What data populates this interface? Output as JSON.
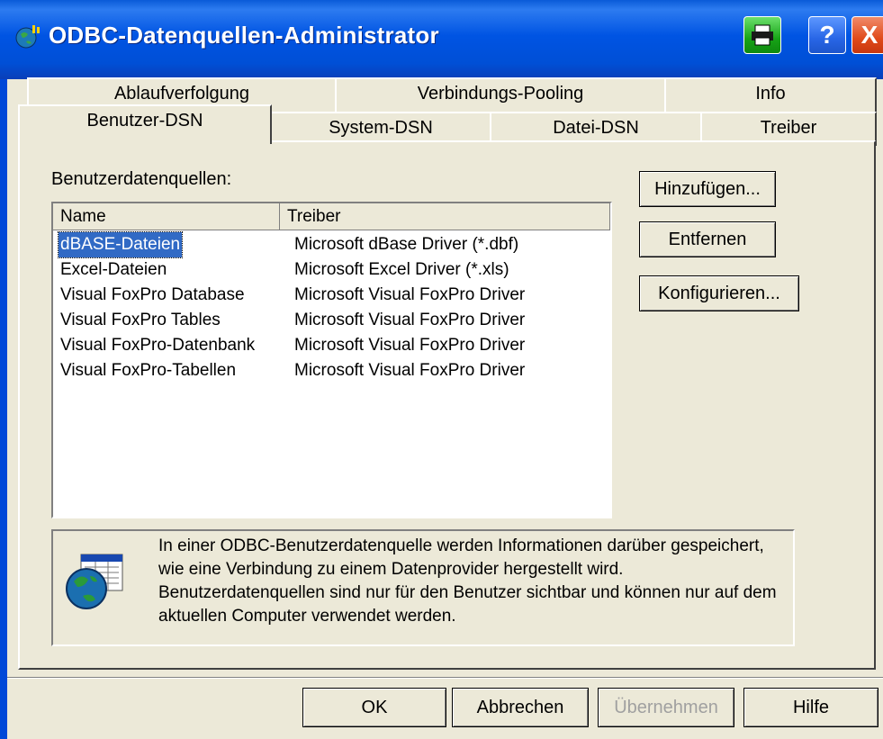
{
  "window": {
    "title": "ODBC-Datenquellen-Administrator"
  },
  "title_buttons": {
    "help": "?",
    "close": "X"
  },
  "tabs_back": [
    {
      "label": "Ablaufverfolgung"
    },
    {
      "label": "Verbindungs-Pooling"
    },
    {
      "label": "Info"
    }
  ],
  "tabs_front": [
    {
      "label": "Benutzer-DSN",
      "active": true
    },
    {
      "label": "System-DSN"
    },
    {
      "label": "Datei-DSN"
    },
    {
      "label": "Treiber"
    }
  ],
  "main": {
    "list_label": "Benutzerdatenquellen:",
    "columns": [
      "Name",
      "Treiber"
    ],
    "rows": [
      {
        "name": "dBASE-Dateien",
        "driver": "Microsoft dBase Driver (*.dbf)",
        "selected": true
      },
      {
        "name": "Excel-Dateien",
        "driver": "Microsoft Excel Driver (*.xls)"
      },
      {
        "name": "Visual FoxPro Database",
        "driver": "Microsoft Visual FoxPro Driver"
      },
      {
        "name": "Visual FoxPro Tables",
        "driver": "Microsoft Visual FoxPro Driver"
      },
      {
        "name": "Visual FoxPro-Datenbank",
        "driver": "Microsoft Visual FoxPro Driver"
      },
      {
        "name": "Visual FoxPro-Tabellen",
        "driver": "Microsoft Visual FoxPro Driver"
      }
    ],
    "buttons": {
      "add": "Hinzufügen...",
      "remove": "Entfernen",
      "configure": "Konfigurieren..."
    },
    "info_text": "In einer ODBC-Benutzerdatenquelle werden Informationen darüber gespeichert, wie eine Verbindung zu einem Datenprovider hergestellt wird. Benutzerdatenquellen sind nur für den Benutzer sichtbar und können nur auf dem aktuellen Computer verwendet werden."
  },
  "footer": {
    "ok": "OK",
    "cancel": "Abbrechen",
    "apply": "Übernehmen",
    "help": "Hilfe"
  },
  "colors": {
    "titlebar": "#0054e3",
    "selection": "#316ac5",
    "face": "#ece9d8"
  }
}
